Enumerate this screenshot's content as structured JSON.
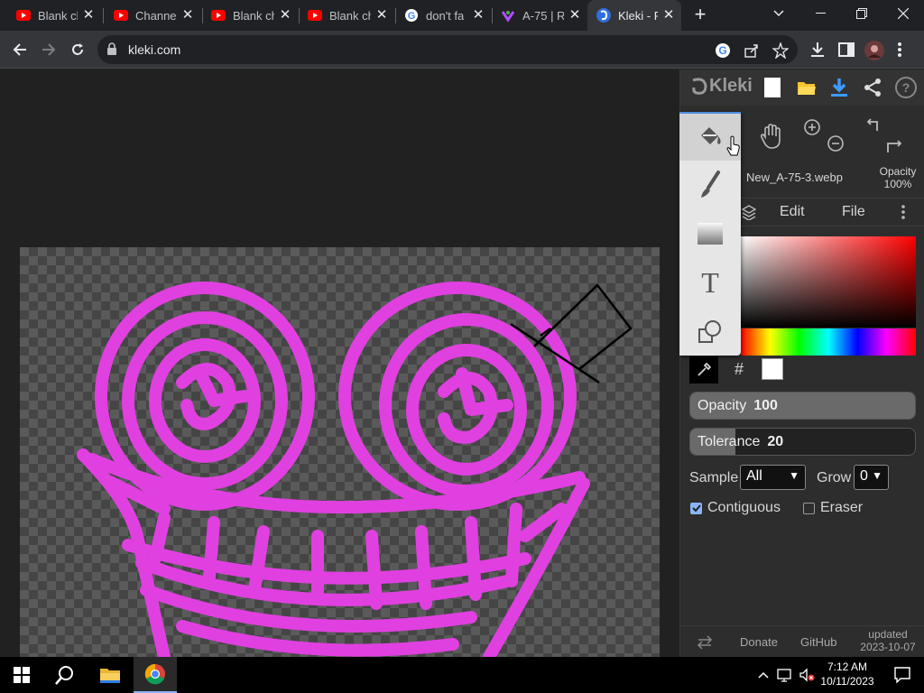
{
  "browser": {
    "tabs": [
      {
        "title": "Blank ch",
        "icon": "youtube-icon"
      },
      {
        "title": "Channel",
        "icon": "youtube-icon"
      },
      {
        "title": "Blank ch",
        "icon": "youtube-icon"
      },
      {
        "title": "Blank ch",
        "icon": "youtube-icon"
      },
      {
        "title": "don't fa",
        "icon": "google-icon"
      },
      {
        "title": "A-75 | R",
        "icon": "site-icon"
      },
      {
        "title": "Kleki - P",
        "icon": "kleki-icon",
        "active": true
      }
    ],
    "url": "kleki.com",
    "accent": "#8ab4f8"
  },
  "kleki": {
    "logo_text": "Kleki",
    "file_name": "New_A-75-3.webp",
    "opacity_label": "Opacity",
    "opacity_value": "100%",
    "menu": {
      "edit": "Edit",
      "file": "File"
    },
    "tools": [
      "fill-bucket-icon",
      "brush-icon",
      "gradient-icon",
      "text-icon",
      "shapes-icon"
    ],
    "text_tool_glyph": "T",
    "color": {
      "hash_label": "#",
      "swatch": "#ffffff"
    },
    "opacity_slider": {
      "label": "Opacity",
      "value": "100",
      "fraction": 1.0
    },
    "tolerance_slider": {
      "label": "Tolerance",
      "value": "20",
      "fraction": 0.2
    },
    "sample": {
      "label": "Sample",
      "value": "All"
    },
    "grow": {
      "label": "Grow",
      "value": "0"
    },
    "contiguous": {
      "label": "Contiguous",
      "checked": true
    },
    "eraser": {
      "label": "Eraser",
      "checked": false
    },
    "footer": {
      "donate": "Donate",
      "github": "GitHub",
      "updated": "updated",
      "date": "2023-10-07"
    },
    "drawing_color": "#e040e0"
  },
  "taskbar": {
    "time": "7:12 AM",
    "date": "10/11/2023"
  }
}
